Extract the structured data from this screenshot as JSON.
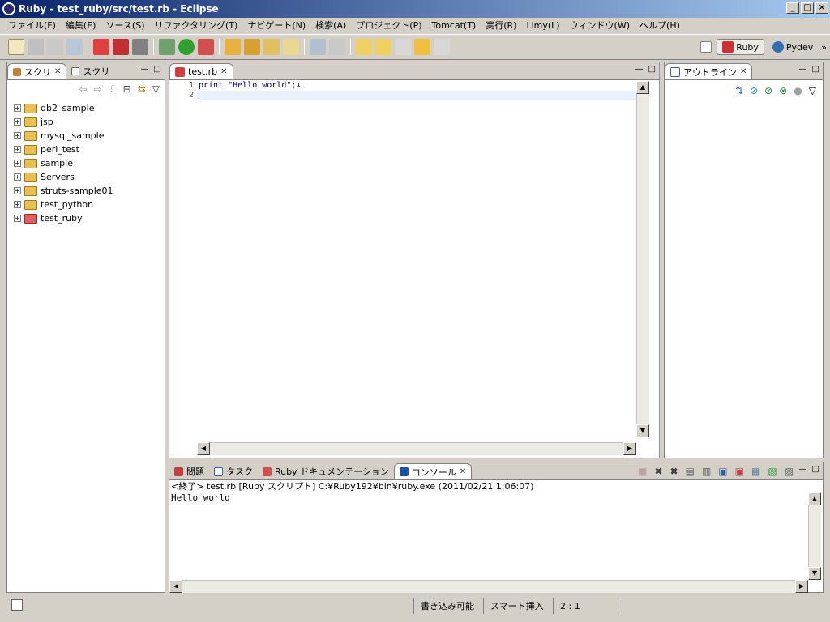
{
  "window": {
    "title": "Ruby - test_ruby/src/test.rb - Eclipse"
  },
  "menu": [
    "ファイル(F)",
    "編集(E)",
    "ソース(S)",
    "リファクタリング(T)",
    "ナビゲート(N)",
    "検索(A)",
    "プロジェクト(P)",
    "Tomcat(T)",
    "実行(R)",
    "Limy(L)",
    "ウィンドウ(W)",
    "ヘルプ(H)"
  ],
  "perspectives": [
    {
      "label": "Ruby",
      "active": true
    },
    {
      "label": "Pydev",
      "active": false
    }
  ],
  "left_panel": {
    "tabs": [
      {
        "label": "スクリ"
      },
      {
        "label": "スクリ"
      }
    ],
    "projects": [
      "db2_sample",
      "jsp",
      "mysql_sample",
      "perl_test",
      "sample",
      "Servers",
      "struts-sample01",
      "test_python",
      "test_ruby"
    ]
  },
  "editor": {
    "tab_label": "test.rb",
    "lines": [
      {
        "num": "1",
        "text": "print \"Hello world\";↓"
      },
      {
        "num": "2",
        "text": ""
      }
    ]
  },
  "outline": {
    "tab_label": "アウトライン"
  },
  "bottom": {
    "tabs": [
      {
        "label": "問題"
      },
      {
        "label": "タスク"
      },
      {
        "label": "Ruby ドキュメンテーション"
      },
      {
        "label": "コンソール"
      }
    ],
    "console_header": "<終了> test.rb [Ruby スクリプト] C:¥Ruby192¥bin¥ruby.exe (2011/02/21 1:06:07)",
    "console_output": "Hello world"
  },
  "status": {
    "writable": "書き込み可能",
    "insert_mode": "スマート挿入",
    "position": "2 : 1"
  }
}
